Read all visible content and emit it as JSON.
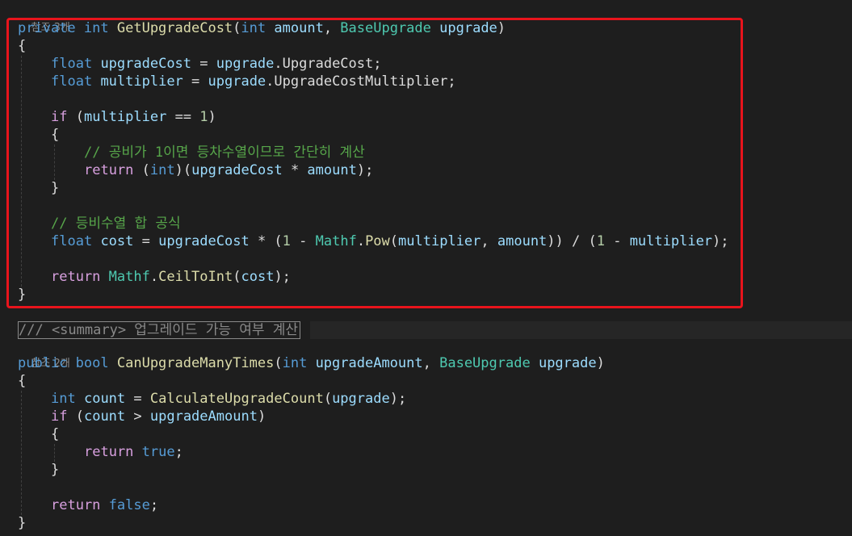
{
  "editor": {
    "block1": {
      "refs": "참조 3개",
      "sig": {
        "mod": "private",
        "ret": "int",
        "name": "GetUpgradeCost",
        "p1_type": "int",
        "p1_name": "amount",
        "p2_type": "BaseUpgrade",
        "p2_name": "upgrade"
      },
      "open_brace": "{",
      "l1": {
        "kw": "float",
        "var": "upgradeCost",
        "eq": " = ",
        "obj": "upgrade",
        "dot": ".",
        "prop": "UpgradeCost",
        "end": ";"
      },
      "l2": {
        "kw": "float",
        "var": "multiplier",
        "eq": " = ",
        "obj": "upgrade",
        "dot": ".",
        "prop": "UpgradeCostMultiplier",
        "end": ";"
      },
      "if_kw": "if",
      "if_open": " (",
      "if_var": "multiplier",
      "if_op": " == ",
      "if_num": "1",
      "if_close": ")",
      "inner_open": "{",
      "comment1": "// 공비가 1이면 등차수열이므로 간단히 계산",
      "ret1_kw": "return",
      "ret1_cast_open": " (",
      "ret1_cast": "int",
      "ret1_cast_close": ")(",
      "ret1_a": "upgradeCost",
      "ret1_op": " * ",
      "ret1_b": "amount",
      "ret1_end": ");",
      "inner_close": "}",
      "comment2": "// 등비수열 합 공식",
      "cost": {
        "kw": "float",
        "var": "cost",
        "eq": " = ",
        "a": "upgradeCost",
        "op1": " * (",
        "n1": "1",
        "op2": " - ",
        "cls": "Mathf",
        "dot": ".",
        "fn": "Pow",
        "open": "(",
        "p1": "multiplier",
        "comma": ", ",
        "p2": "amount",
        "op3": ")) / (",
        "n2": "1",
        "op4": " - ",
        "p3": "multiplier",
        "end": ");"
      },
      "ret2_kw": "return",
      "ret2_cls": "Mathf",
      "ret2_dot": ".",
      "ret2_fn": "CeilToInt",
      "ret2_open": "(",
      "ret2_arg": "cost",
      "ret2_end": ");",
      "close_brace": "}"
    },
    "doc_comment": "/// <summary> 업그레이드 가능 여부 계산",
    "block2": {
      "refs": "참조 2개",
      "sig": {
        "mod": "public",
        "ret": "bool",
        "name": "CanUpgradeManyTimes",
        "p1_type": "int",
        "p1_name": "upgradeAmount",
        "p2_type": "BaseUpgrade",
        "p2_name": "upgrade"
      },
      "open_brace": "{",
      "l1": {
        "kw": "int",
        "var": "count",
        "eq": " = ",
        "fn": "CalculateUpgradeCount",
        "open": "(",
        "arg": "upgrade",
        "end": ");"
      },
      "if_kw": "if",
      "if_open": " (",
      "if_a": "count",
      "if_op": " > ",
      "if_b": "upgradeAmount",
      "if_close": ")",
      "inner_open": "{",
      "ret_true_kw": "return",
      "ret_true_val": "true",
      "ret_true_end": ";",
      "inner_close": "}",
      "ret_false_kw": "return",
      "ret_false_val": "false",
      "ret_false_end": ";",
      "close_brace": "}"
    },
    "colors": {
      "background": "#1e1e1e",
      "highlight_box": "#e8141c",
      "keyword": "#569cd6",
      "control": "#d8a0df",
      "type": "#4ec9b0",
      "method": "#dcdcaa",
      "variable": "#9cdcfe",
      "number": "#b5cea8",
      "comment": "#57a64a"
    }
  }
}
